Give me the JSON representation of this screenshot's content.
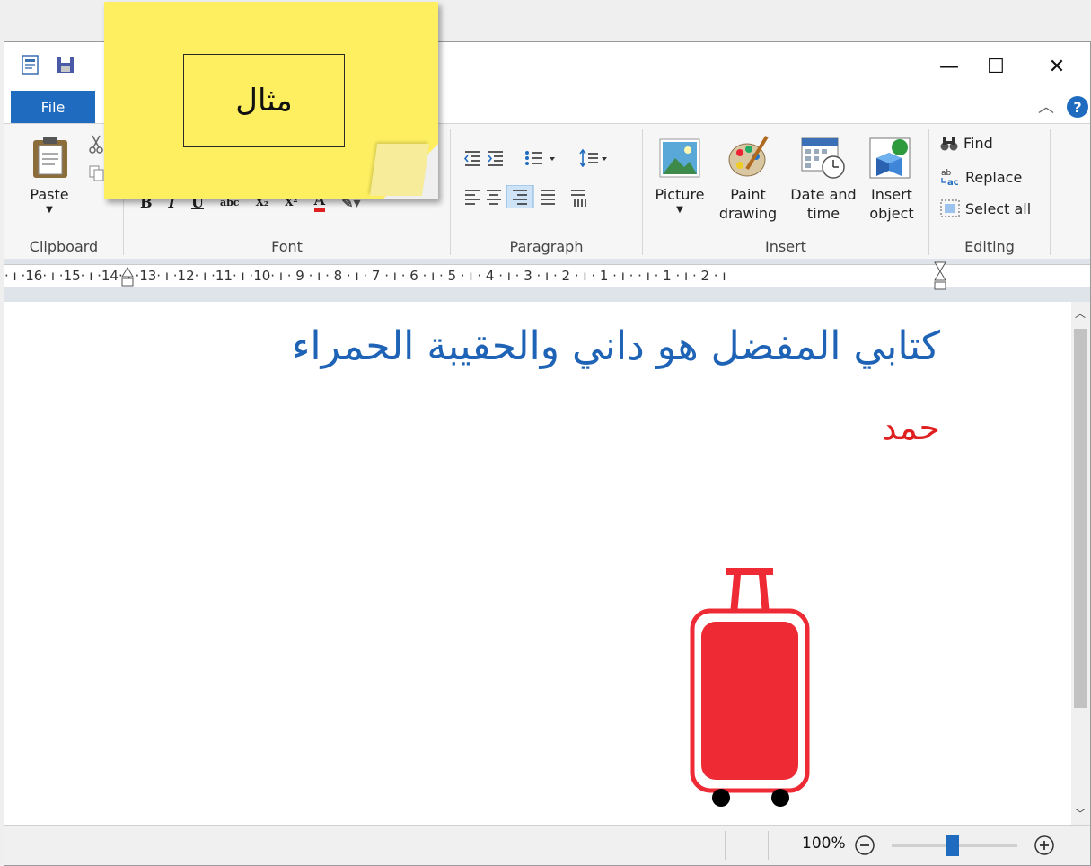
{
  "toolbar": {
    "file_tab": "File"
  },
  "window_controls": {
    "minimize": "—",
    "maximize": "☐",
    "close": "✕"
  },
  "ribbon": {
    "clipboard": {
      "paste": "Paste",
      "label": "Clipboard"
    },
    "font": {
      "label": "Font"
    },
    "paragraph": {
      "label": "Paragraph"
    },
    "insert": {
      "picture": "Picture",
      "paint_line1": "Paint",
      "paint_line2": "drawing",
      "datetime_line1": "Date and",
      "datetime_line2": "time",
      "object_line1": "Insert",
      "object_line2": "object",
      "label": "Insert"
    },
    "editing": {
      "find": "Find",
      "replace": "Replace",
      "select_all": "Select all",
      "label": "Editing"
    }
  },
  "ruler": {
    "text": "· ı ·16· ı ·15·  ı ·14· ı ·13· ı ·12· ı ·11· ı ·10· ı · 9 · ı · 8 · ı · 7 · ı · 6 · ı · 5 · ı · 4 · ı · 3 · ı · 2 · ı · 1 · ı ·   · ı · 1 · ı · 2 · ı"
  },
  "document": {
    "title_text": "كتابي المفضل هو داني والحقيبة الحمراء",
    "name_text": "حمد",
    "title_color": "#1e63b6",
    "name_color": "#e02020"
  },
  "status": {
    "zoom": "100%",
    "zoom_level_percent": 100
  },
  "note": {
    "text": "مثال",
    "color": "#fdef60"
  },
  "colors": {
    "accent": "#1e6bbf",
    "suitcase": "#ee2a35"
  }
}
